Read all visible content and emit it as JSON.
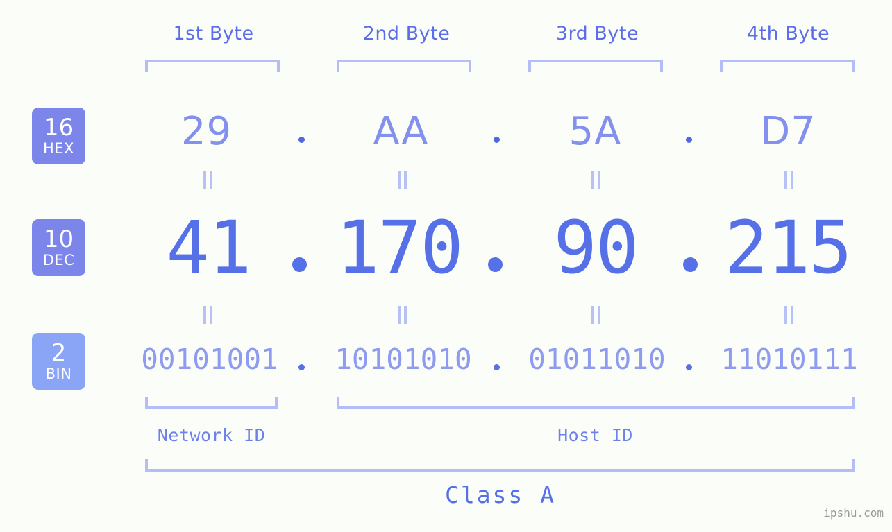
{
  "background_color": "#fafdf8",
  "accent_colors": {
    "badge_hex": "#7b85ea",
    "badge_dec": "#7b85ea",
    "badge_bin": "#8aa5f5",
    "byte_label": "#5b6ee8",
    "hex_value": "#8390ee",
    "dec_value": "#5670e8",
    "bin_value": "#8e9bf0",
    "bracket": "#b4bdf7",
    "equals": "#b7c0f7",
    "watermark": "#9a9a9a"
  },
  "byte_headers": [
    {
      "label": "1st Byte"
    },
    {
      "label": "2nd Byte"
    },
    {
      "label": "3rd Byte"
    },
    {
      "label": "4th Byte"
    }
  ],
  "rows": [
    {
      "badge_number": "16",
      "badge_name": "HEX",
      "values": [
        "29",
        "AA",
        "5A",
        "D7"
      ]
    },
    {
      "badge_number": "10",
      "badge_name": "DEC",
      "values": [
        "41",
        "170",
        "90",
        "215"
      ]
    },
    {
      "badge_number": "2",
      "badge_name": "BIN",
      "values": [
        "00101001",
        "10101010",
        "01011010",
        "11010111"
      ]
    }
  ],
  "separator": ".",
  "equals_symbol": "=",
  "segments": {
    "network_id": "Network ID",
    "host_id": "Host ID"
  },
  "class_label": "Class A",
  "watermark": "ipshu.com"
}
